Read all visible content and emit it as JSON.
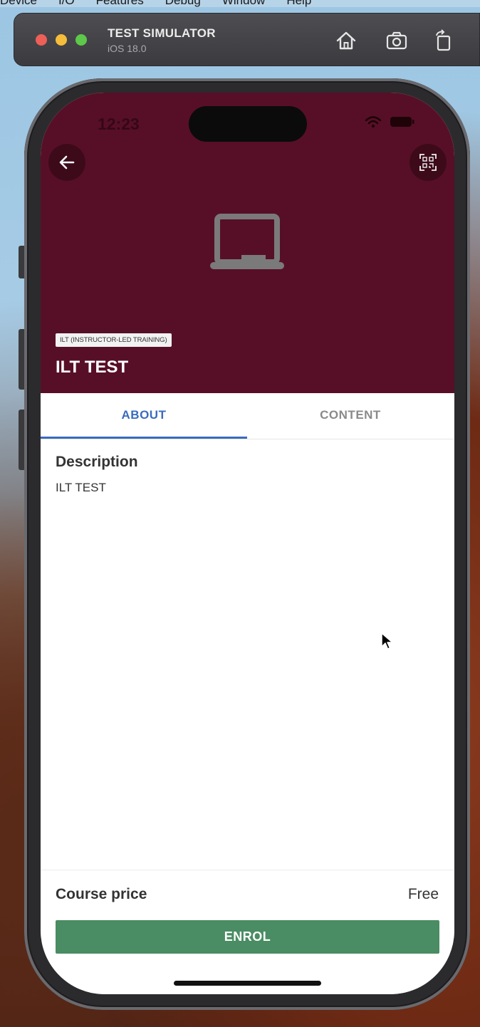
{
  "menubar": {
    "items": [
      "Device",
      "I/O",
      "Features",
      "Debug",
      "Window",
      "Help"
    ]
  },
  "simulator": {
    "title": "TEST SIMULATOR",
    "subtitle": "iOS 18.0",
    "icons": [
      "home-icon",
      "screenshot-icon",
      "rotate-icon"
    ]
  },
  "status_bar": {
    "time": "12:23",
    "icons": [
      "wifi-icon",
      "battery-icon"
    ]
  },
  "header": {
    "back_icon": "arrow-left-icon",
    "qr_icon": "qr-scan-icon",
    "placeholder_icon": "laptop-icon",
    "tag": "ILT (INSTRUCTOR-LED TRAINING)",
    "title": "ILT TEST",
    "background_color": "#570f27"
  },
  "tabs": [
    {
      "label": "ABOUT",
      "active": true
    },
    {
      "label": "CONTENT",
      "active": false
    }
  ],
  "about": {
    "heading": "Description",
    "text": "ILT TEST"
  },
  "footer": {
    "price_label": "Course price",
    "price_value": "Free",
    "enrol_label": "ENROL",
    "enrol_color": "#4a8c63"
  },
  "accent_color": "#3a6bbf"
}
